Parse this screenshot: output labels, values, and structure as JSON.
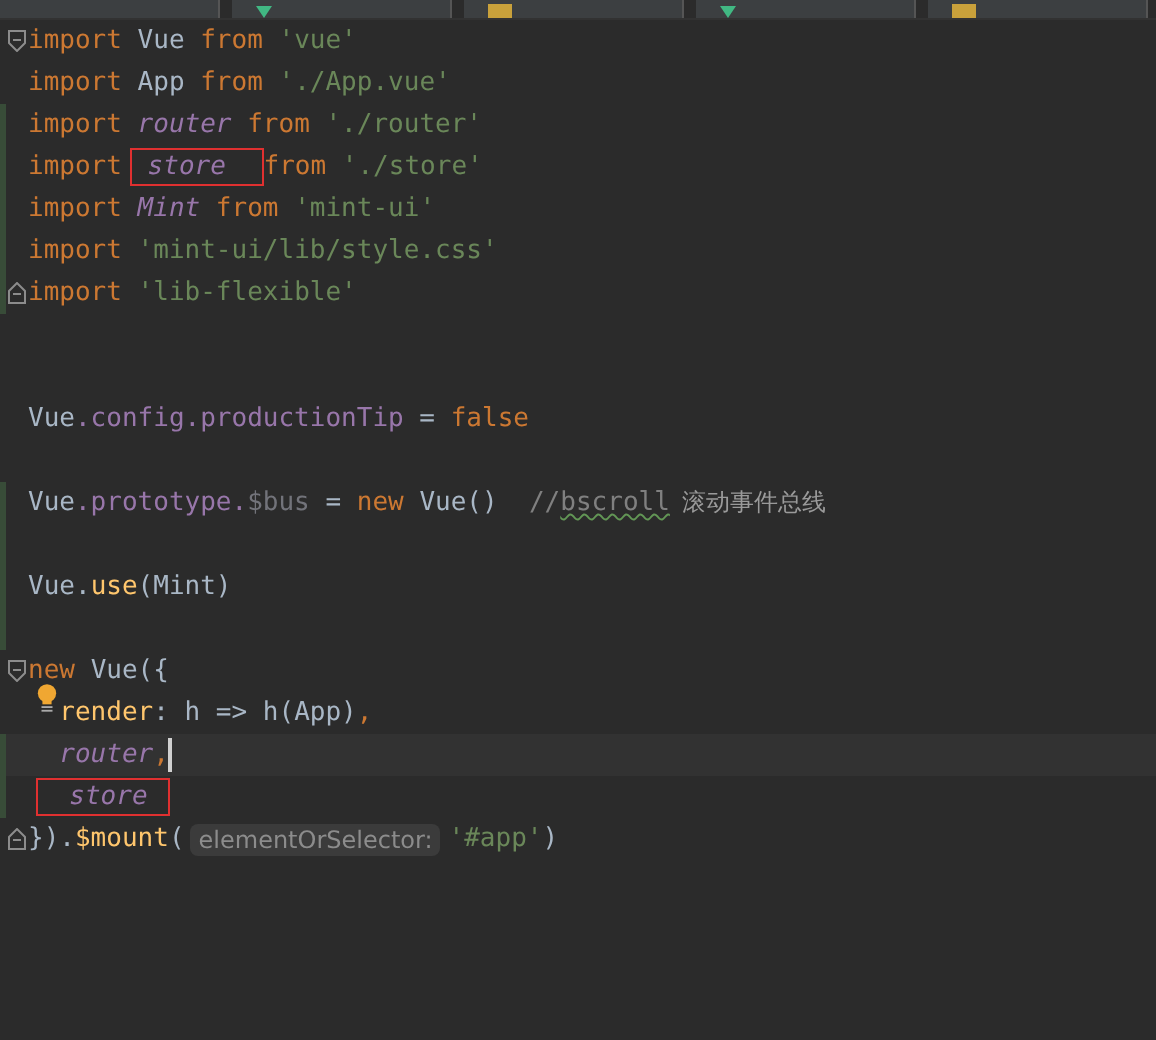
{
  "editor_tabs": [
    {
      "kind": "plain",
      "selected": false
    },
    {
      "kind": "vue",
      "selected": false
    },
    {
      "kind": "js",
      "selected": false
    },
    {
      "kind": "vue",
      "selected": false
    },
    {
      "kind": "js",
      "selected": false
    }
  ],
  "lines": [
    {
      "opens_block": true,
      "closes_block": false,
      "changed": false,
      "current": false,
      "bulb": false,
      "tokens": [
        {
          "text": "import ",
          "kind": "keyword",
          "boxed": false
        },
        {
          "text": "Vue ",
          "kind": "identifier",
          "boxed": false
        },
        {
          "text": "from ",
          "kind": "keyword",
          "boxed": false
        },
        {
          "text": "'vue'",
          "kind": "string",
          "boxed": false
        }
      ]
    },
    {
      "opens_block": false,
      "closes_block": false,
      "changed": false,
      "current": false,
      "bulb": false,
      "tokens": [
        {
          "text": "import ",
          "kind": "keyword",
          "boxed": false
        },
        {
          "text": "App ",
          "kind": "identifier",
          "boxed": false
        },
        {
          "text": "from ",
          "kind": "keyword",
          "boxed": false
        },
        {
          "text": "'./App.vue'",
          "kind": "string",
          "boxed": false
        }
      ]
    },
    {
      "opens_block": false,
      "closes_block": false,
      "changed": true,
      "current": false,
      "bulb": false,
      "tokens": [
        {
          "text": "import ",
          "kind": "keyword",
          "boxed": false
        },
        {
          "text": "router",
          "kind": "variable",
          "boxed": false
        },
        {
          "text": " from ",
          "kind": "keyword",
          "boxed": false
        },
        {
          "text": "'./router'",
          "kind": "string",
          "boxed": false
        }
      ]
    },
    {
      "opens_block": false,
      "closes_block": false,
      "changed": true,
      "current": false,
      "bulb": false,
      "tokens": [
        {
          "text": "import",
          "kind": "keyword",
          "boxed": false
        },
        {
          "text": " store ",
          "kind": "variable",
          "boxed": true
        },
        {
          "text": "from ",
          "kind": "keyword",
          "boxed": false
        },
        {
          "text": "'./store'",
          "kind": "string",
          "boxed": false
        }
      ]
    },
    {
      "opens_block": false,
      "closes_block": false,
      "changed": true,
      "current": false,
      "bulb": false,
      "tokens": [
        {
          "text": "import ",
          "kind": "keyword",
          "boxed": false
        },
        {
          "text": "Mint",
          "kind": "variable",
          "boxed": false
        },
        {
          "text": " from ",
          "kind": "keyword",
          "boxed": false
        },
        {
          "text": "'mint-ui'",
          "kind": "string",
          "boxed": false
        }
      ]
    },
    {
      "opens_block": false,
      "closes_block": false,
      "changed": true,
      "current": false,
      "bulb": false,
      "tokens": [
        {
          "text": "import ",
          "kind": "keyword",
          "boxed": false
        },
        {
          "text": "'mint-ui/lib/style.css'",
          "kind": "string",
          "boxed": false
        }
      ]
    },
    {
      "opens_block": false,
      "closes_block": true,
      "changed": true,
      "current": false,
      "bulb": false,
      "tokens": [
        {
          "text": "import ",
          "kind": "keyword",
          "boxed": false
        },
        {
          "text": "'lib-flexible'",
          "kind": "string",
          "boxed": false
        }
      ]
    },
    {
      "opens_block": false,
      "closes_block": false,
      "changed": false,
      "current": false,
      "bulb": false
    },
    {
      "opens_block": false,
      "closes_block": false,
      "changed": false,
      "current": false,
      "bulb": false
    },
    {
      "opens_block": false,
      "closes_block": false,
      "changed": false,
      "current": false,
      "bulb": false,
      "tokens": [
        {
          "text": "Vue",
          "kind": "identifier",
          "boxed": false
        },
        {
          "text": ".config.productionTip",
          "kind": "property",
          "boxed": false
        },
        {
          "text": " = ",
          "kind": "identifier",
          "boxed": false
        },
        {
          "text": "false",
          "kind": "keyword",
          "boxed": false
        }
      ]
    },
    {
      "opens_block": false,
      "closes_block": false,
      "changed": false,
      "current": false,
      "bulb": false
    },
    {
      "opens_block": false,
      "closes_block": false,
      "changed": true,
      "current": false,
      "bulb": false,
      "tokens": [
        {
          "text": "Vue",
          "kind": "identifier",
          "boxed": false
        },
        {
          "text": ".prototype.",
          "kind": "property",
          "boxed": false
        },
        {
          "text": "$bus",
          "kind": "unused",
          "boxed": false
        },
        {
          "text": " = ",
          "kind": "identifier",
          "boxed": false
        },
        {
          "text": "new ",
          "kind": "keyword",
          "boxed": false
        },
        {
          "text": "Vue()",
          "kind": "identifier",
          "boxed": false
        },
        {
          "text": "  //",
          "kind": "comment",
          "boxed": false
        },
        {
          "text": "bscroll",
          "kind": "typo",
          "boxed": false
        },
        {
          "text": "滚动事件总线",
          "kind": "cjk_comment",
          "boxed": false
        }
      ]
    },
    {
      "opens_block": false,
      "closes_block": false,
      "changed": true,
      "current": false,
      "bulb": false
    },
    {
      "opens_block": false,
      "closes_block": false,
      "changed": true,
      "current": false,
      "bulb": false,
      "tokens": [
        {
          "text": "Vue.",
          "kind": "identifier",
          "boxed": false
        },
        {
          "text": "use",
          "kind": "function",
          "boxed": false
        },
        {
          "text": "(Mint)",
          "kind": "identifier",
          "boxed": false
        }
      ]
    },
    {
      "opens_block": false,
      "closes_block": false,
      "changed": true,
      "current": false,
      "bulb": false
    },
    {
      "opens_block": true,
      "closes_block": false,
      "changed": false,
      "current": false,
      "bulb": false,
      "tokens": [
        {
          "text": "new ",
          "kind": "keyword",
          "boxed": false
        },
        {
          "text": "Vue({",
          "kind": "identifier",
          "boxed": false
        }
      ]
    },
    {
      "opens_block": false,
      "closes_block": false,
      "changed": false,
      "current": false,
      "bulb": true,
      "tokens": [
        {
          "text": "  render",
          "kind": "function",
          "boxed": false
        },
        {
          "text": ": h => h(App)",
          "kind": "identifier",
          "boxed": false
        },
        {
          "text": ",",
          "kind": "keyword",
          "boxed": false
        }
      ]
    },
    {
      "opens_block": false,
      "closes_block": false,
      "changed": true,
      "current": true,
      "bulb": false,
      "tokens": [
        {
          "text": "  router",
          "kind": "variable",
          "boxed": false
        },
        {
          "text": ",",
          "kind": "keyword",
          "boxed": false
        }
      ]
    },
    {
      "opens_block": false,
      "closes_block": false,
      "changed": true,
      "current": false,
      "bulb": false,
      "tokens": [
        {
          "text": "  store",
          "kind": "variable",
          "boxed": true
        }
      ]
    },
    {
      "opens_block": false,
      "closes_block": true,
      "changed": false,
      "current": false,
      "bulb": false,
      "tokens": [
        {
          "text": "}).",
          "kind": "identifier",
          "boxed": false
        },
        {
          "text": "$mount",
          "kind": "function",
          "boxed": false
        },
        {
          "text": "(",
          "kind": "identifier",
          "boxed": false
        },
        {
          "text": "elementOrSelector:",
          "kind": "hint",
          "boxed": false
        },
        {
          "text": "'#app'",
          "kind": "string",
          "boxed": false
        },
        {
          "text": ")",
          "kind": "identifier",
          "boxed": false
        }
      ]
    }
  ]
}
